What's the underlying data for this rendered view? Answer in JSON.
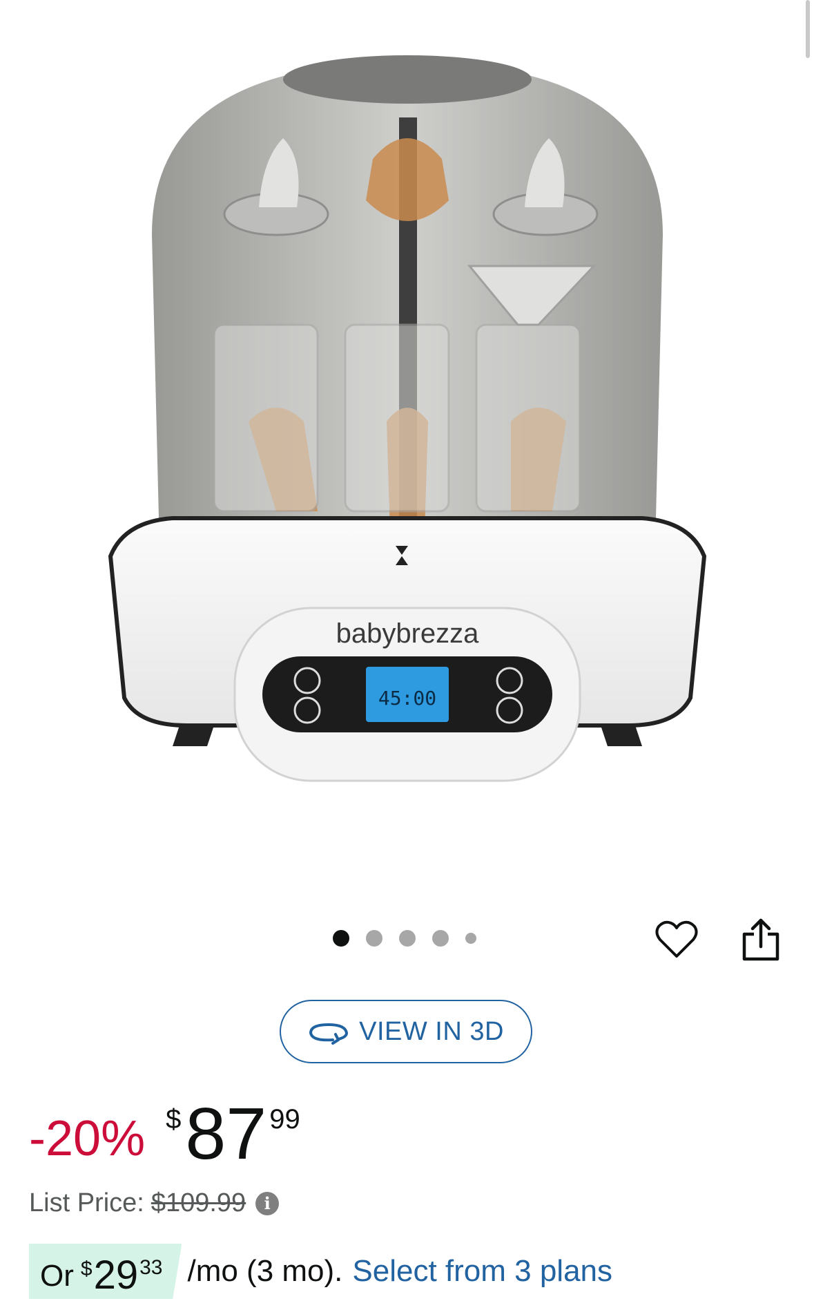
{
  "product": {
    "brand_text": "babybrezza",
    "display_reading": "45:00",
    "carousel": {
      "count": 5,
      "active_index": 0
    }
  },
  "actions": {
    "wishlist_icon": "heart-icon",
    "share_icon": "share-icon",
    "view3d_label": "VIEW IN 3D",
    "view3d_icon": "rotate-3d-icon"
  },
  "pricing": {
    "discount": "-20%",
    "currency": "$",
    "price_whole": "87",
    "price_fraction": "99",
    "list_price_label": "List Price:",
    "list_price": "$109.99",
    "info_icon": "info-icon",
    "plan": {
      "prefix": "Or",
      "currency": "$",
      "monthly_whole": "29",
      "monthly_fraction": "33",
      "term_text": "/mo (3 mo).",
      "link_text": "Select from 3 plans"
    }
  },
  "colors": {
    "link": "#2162a1",
    "discount": "#cc0c39",
    "plan_badge_bg": "#d6f3e7",
    "text_secondary": "#565959"
  }
}
